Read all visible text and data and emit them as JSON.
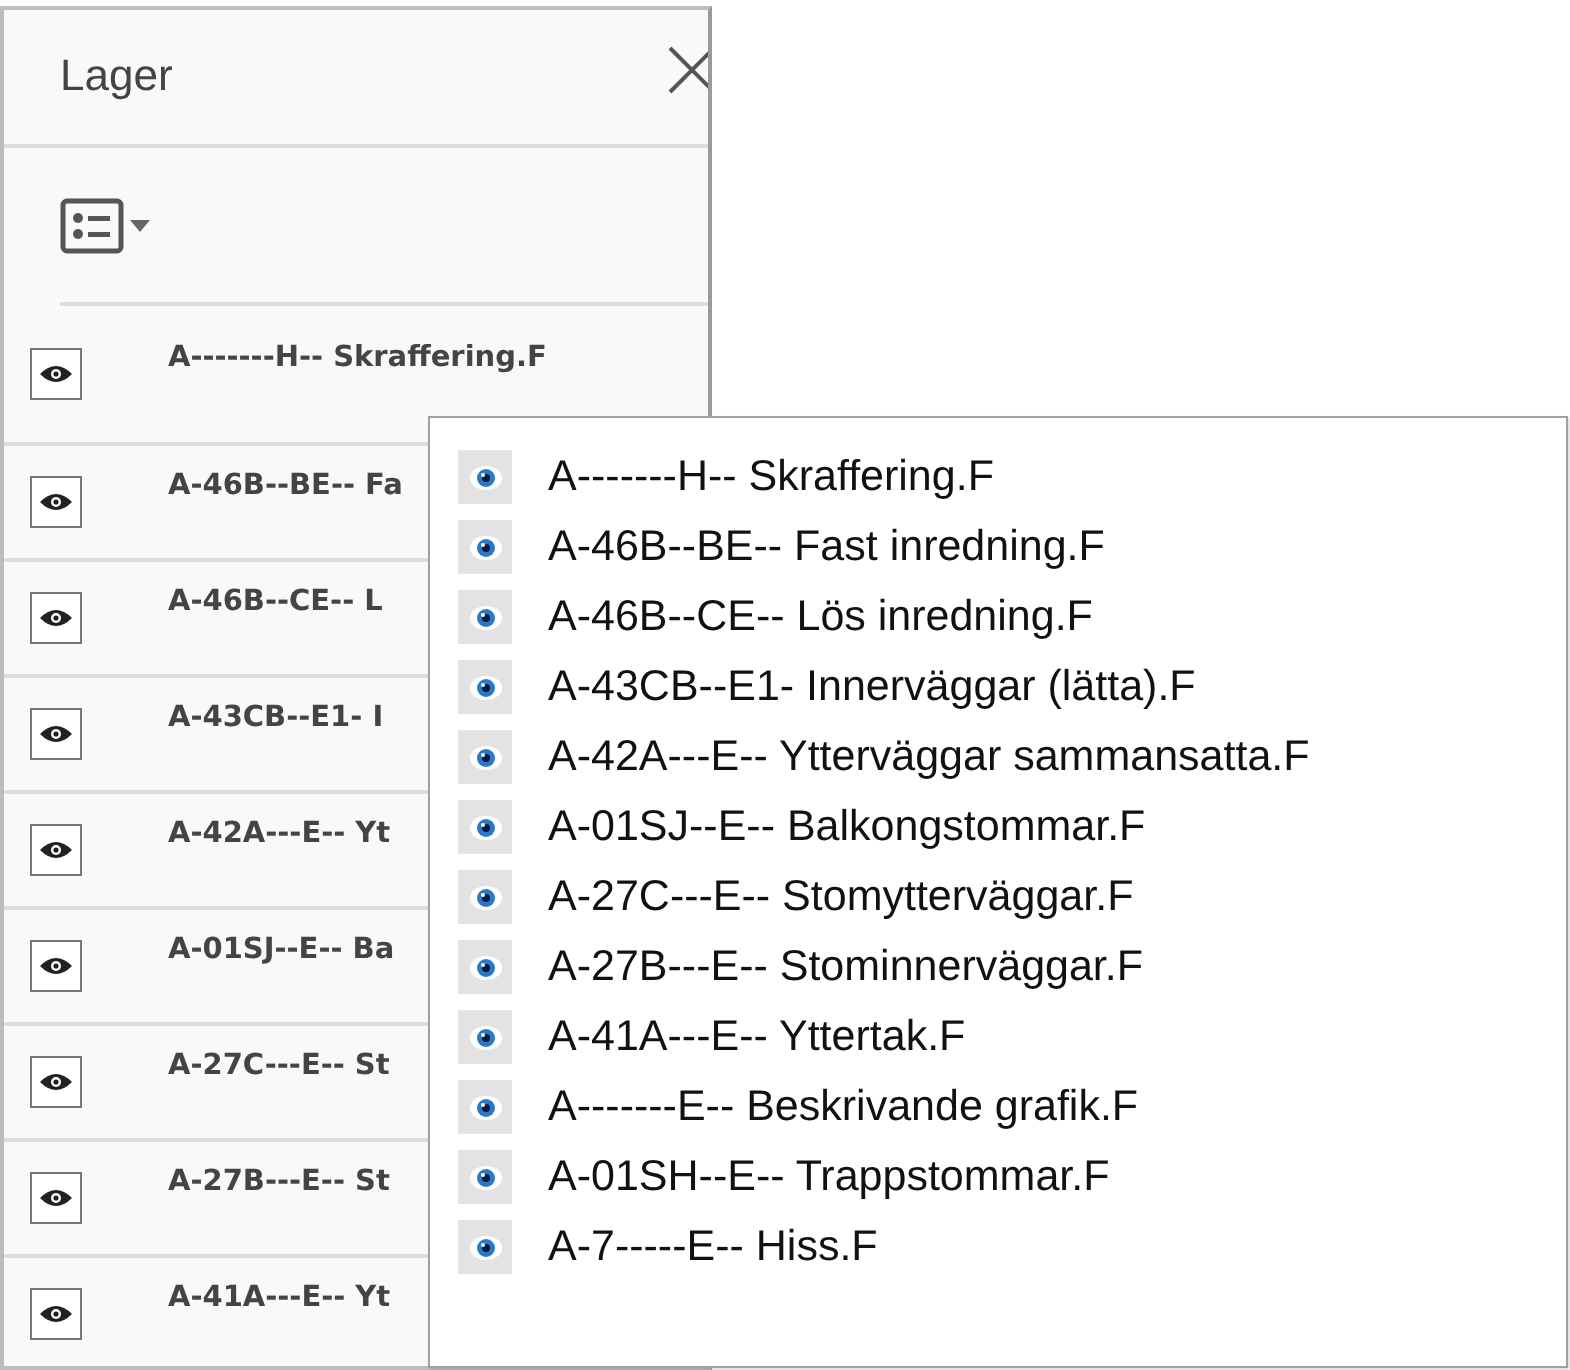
{
  "panel": {
    "title": "Lager",
    "layers": [
      {
        "name": "A-------H-- Skraffering.F",
        "visible": true
      },
      {
        "name": "A-46B--BE-- Fa",
        "visible": true
      },
      {
        "name": "A-46B--CE-- L",
        "visible": true
      },
      {
        "name": "A-43CB--E1- I",
        "visible": true
      },
      {
        "name": "A-42A---E-- Yt",
        "visible": true
      },
      {
        "name": "A-01SJ--E-- Ba",
        "visible": true
      },
      {
        "name": "A-27C---E-- St",
        "visible": true
      },
      {
        "name": "A-27B---E-- St",
        "visible": true
      },
      {
        "name": "A-41A---E-- Yt",
        "visible": true
      }
    ]
  },
  "popup": {
    "layers": [
      {
        "name": "A-------H-- Skraffering.F",
        "visible": true
      },
      {
        "name": "A-46B--BE-- Fast inredning.F",
        "visible": true
      },
      {
        "name": "A-46B--CE-- Lös inredning.F",
        "visible": true
      },
      {
        "name": "A-43CB--E1- Innerväggar (lätta).F",
        "visible": true
      },
      {
        "name": "A-42A---E-- Ytterväggar sammansatta.F",
        "visible": true
      },
      {
        "name": "A-01SJ--E-- Balkongstommar.F",
        "visible": true
      },
      {
        "name": "A-27C---E-- Stomytterväggar.F",
        "visible": true
      },
      {
        "name": "A-27B---E-- Stominnerväggar.F",
        "visible": true
      },
      {
        "name": "A-41A---E-- Yttertak.F",
        "visible": true
      },
      {
        "name": "A-------E-- Beskrivande grafik.F",
        "visible": true
      },
      {
        "name": "A-01SH--E-- Trappstommar.F",
        "visible": true
      },
      {
        "name": "A-7-----E-- Hiss.F",
        "visible": true
      }
    ]
  }
}
